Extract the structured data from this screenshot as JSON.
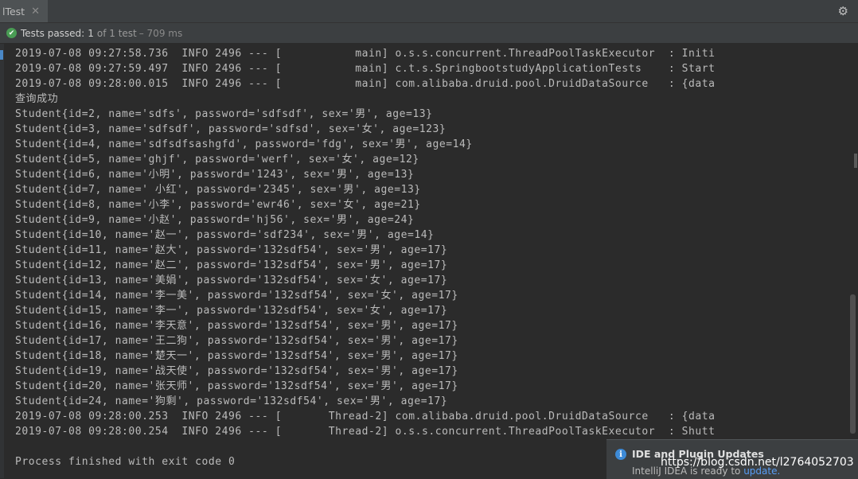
{
  "tab": {
    "title": "lTest",
    "close": "✕"
  },
  "toolbar": {
    "settings_icon": "⚙"
  },
  "status": {
    "icon": "✔",
    "label": "Tests passed:",
    "count": "1",
    "of": "of 1 test",
    "time": "– 709 ms"
  },
  "console": {
    "lines": [
      "2019-07-08 09:27:58.736  INFO 2496 --- [           main] o.s.s.concurrent.ThreadPoolTaskExecutor  : Initi",
      "2019-07-08 09:27:59.497  INFO 2496 --- [           main] c.t.s.SpringbootstudyApplicationTests    : Start",
      "2019-07-08 09:28:00.015  INFO 2496 --- [           main] com.alibaba.druid.pool.DruidDataSource   : {data",
      "查询成功",
      "Student{id=2, name='sdfs', password='sdfsdf', sex='男', age=13}",
      "Student{id=3, name='sdfsdf', password='sdfsd', sex='女', age=123}",
      "Student{id=4, name='sdfsdfsashgfd', password='fdg', sex='男', age=14}",
      "Student{id=5, name='ghjf', password='werf', sex='女', age=12}",
      "Student{id=6, name='小明', password='1243', sex='男', age=13}",
      "Student{id=7, name=' 小红', password='2345', sex='男', age=13}",
      "Student{id=8, name='小李', password='ewr46', sex='女', age=21}",
      "Student{id=9, name='小赵', password='hj56', sex='男', age=24}",
      "Student{id=10, name='赵一', password='sdf234', sex='男', age=14}",
      "Student{id=11, name='赵大', password='132sdf54', sex='男', age=17}",
      "Student{id=12, name='赵二', password='132sdf54', sex='男', age=17}",
      "Student{id=13, name='美娟', password='132sdf54', sex='女', age=17}",
      "Student{id=14, name='李一美', password='132sdf54', sex='女', age=17}",
      "Student{id=15, name='李一', password='132sdf54', sex='女', age=17}",
      "Student{id=16, name='李天意', password='132sdf54', sex='男', age=17}",
      "Student{id=17, name='王二狗', password='132sdf54', sex='男', age=17}",
      "Student{id=18, name='楚天一', password='132sdf54', sex='男', age=17}",
      "Student{id=19, name='战天使', password='132sdf54', sex='男', age=17}",
      "Student{id=20, name='张天师', password='132sdf54', sex='男', age=17}",
      "Student{id=24, name='狗剩', password='132sdf54', sex='男', age=17}",
      "2019-07-08 09:28:00.253  INFO 2496 --- [       Thread-2] com.alibaba.druid.pool.DruidDataSource   : {data",
      "2019-07-08 09:28:00.254  INFO 2496 --- [       Thread-2] o.s.s.concurrent.ThreadPoolTaskExecutor  : Shutt",
      "",
      "Process finished with exit code 0"
    ]
  },
  "notification": {
    "icon": "i",
    "title": "IDE and Plugin Updates",
    "text": "IntelliJ IDEA is ready to ",
    "link": "update."
  },
  "watermark": "https://blog.csdn.net/l2764052703"
}
